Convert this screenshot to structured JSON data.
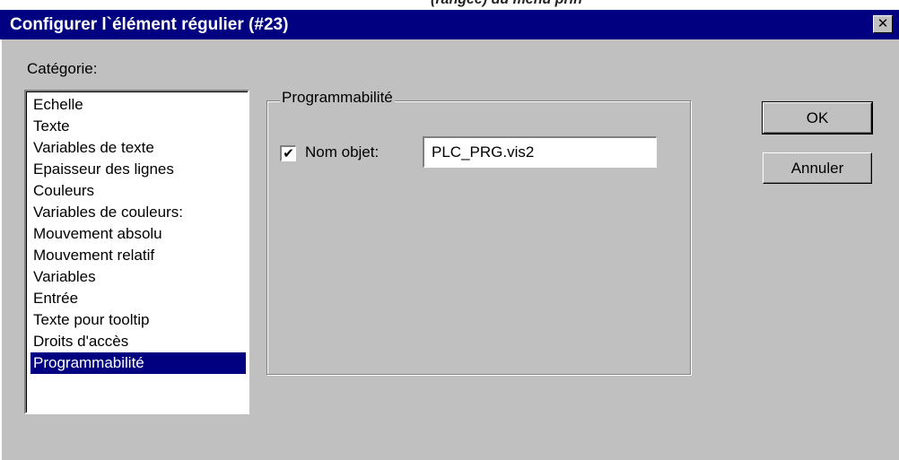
{
  "page_top_fragment": "(rangée) du menu prin",
  "dialog": {
    "title": "Configurer l`élément régulier (#23)",
    "close_symbol": "✕"
  },
  "category": {
    "label": "Catégorie:",
    "items": [
      "Echelle",
      "Texte",
      "Variables de texte",
      "Epaisseur des lignes",
      "Couleurs",
      "Variables de couleurs:",
      "Mouvement absolu",
      "Mouvement relatif",
      "Variables",
      "Entrée",
      "Texte pour tooltip",
      "Droits d'accès",
      "Programmabilité"
    ],
    "selected_index": 12
  },
  "group": {
    "title": "Programmabilité",
    "checkbox_checked": true,
    "checkbox_mark": "✔",
    "checkbox_label": "Nom objet:",
    "object_name_value": "PLC_PRG.vis2"
  },
  "buttons": {
    "ok": "OK",
    "cancel": "Annuler"
  }
}
